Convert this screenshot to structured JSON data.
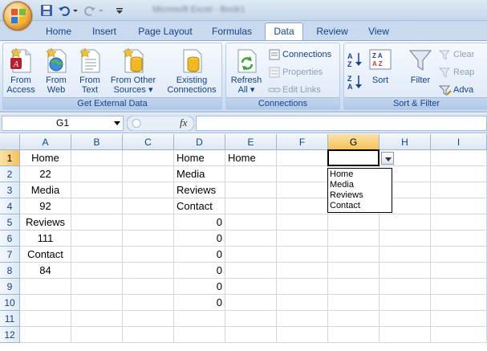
{
  "qat": {
    "office_button": "office-button",
    "save_icon": "save-icon",
    "undo_icon": "undo-icon",
    "redo_icon": "redo-icon",
    "customize_icon": "customize-qat-icon"
  },
  "titlebar": {
    "title": "Microsoft Excel - Book1"
  },
  "tabs": [
    {
      "label": "Home"
    },
    {
      "label": "Insert"
    },
    {
      "label": "Page Layout"
    },
    {
      "label": "Formulas"
    },
    {
      "label": "Data",
      "active": true
    },
    {
      "label": "Review"
    },
    {
      "label": "View"
    }
  ],
  "ribbon": {
    "get_external_data": {
      "label": "Get External Data",
      "from_access": [
        "From",
        "Access"
      ],
      "from_web": [
        "From",
        "Web"
      ],
      "from_text": [
        "From",
        "Text"
      ],
      "from_other": [
        "From Other",
        "Sources ▾"
      ],
      "existing": [
        "Existing",
        "Connections"
      ]
    },
    "connections": {
      "label": "Connections",
      "refresh": [
        "Refresh",
        "All ▾"
      ],
      "connections": "Connections",
      "properties": "Properties",
      "edit_links": "Edit Links"
    },
    "sort_filter": {
      "label": "Sort & Filter",
      "sort": "Sort",
      "filter": "Filter",
      "clear": "Clear",
      "reapply": "Reap",
      "advanced": "Adva"
    }
  },
  "formula_bar": {
    "name_box": "G1",
    "fx_label": "fx",
    "formula": ""
  },
  "columns": [
    "A",
    "B",
    "C",
    "D",
    "E",
    "F",
    "G",
    "H",
    "I"
  ],
  "rows": [
    "1",
    "2",
    "3",
    "4",
    "5",
    "6",
    "7",
    "8",
    "9",
    "10",
    "11",
    "12"
  ],
  "cells": {
    "A1": "Home",
    "A2": "22",
    "A3": "Media",
    "A4": "92",
    "A5": "Reviews",
    "A6": "111",
    "A7": "Contact",
    "A8": "84",
    "D1": "Home",
    "D2": "Media",
    "D3": "Reviews",
    "D4": "Contact",
    "D5": "0",
    "D6": "0",
    "D7": "0",
    "D8": "0",
    "D9": "0",
    "D10": "0",
    "E1": "Home"
  },
  "selected": {
    "column": "G",
    "row": "1"
  },
  "dropdown_list": [
    "Home",
    "Media",
    "Reviews",
    "Contact"
  ]
}
